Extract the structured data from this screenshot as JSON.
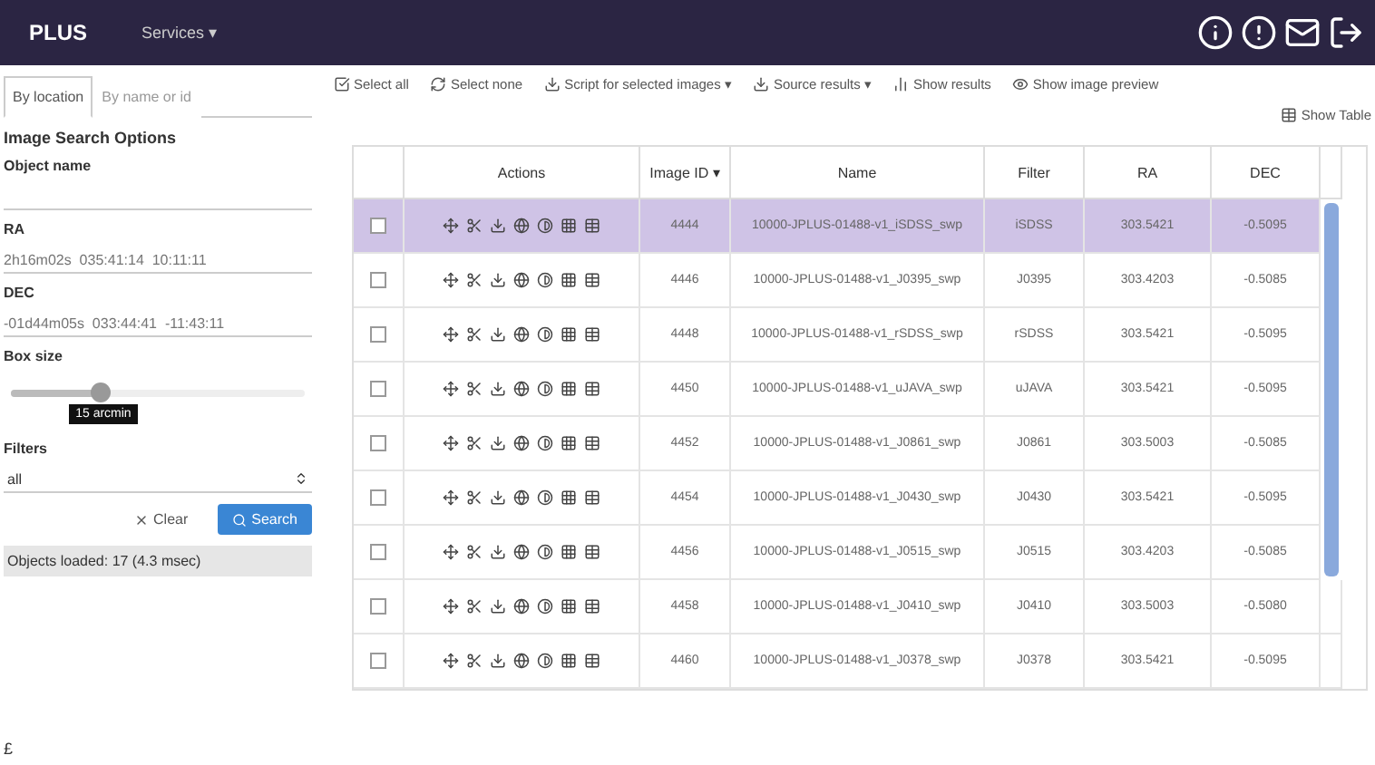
{
  "header": {
    "logo": "PLUS",
    "menu": "Services ▾"
  },
  "sidebar": {
    "tabs": [
      {
        "label": "By location",
        "selected": true
      },
      {
        "label": "By name or id",
        "selected": false
      }
    ],
    "title": "Image Search Options",
    "fields": [
      {
        "label": "Object name"
      },
      {
        "label": "RA",
        "placeholder": "2h16m02s  035:41:14  10:11:11"
      },
      {
        "label": "DEC",
        "placeholder": "-01d44m05s  033:44:41  -11:43:11"
      }
    ],
    "slider": {
      "label": "Box size",
      "level": 0.3,
      "tooltip": "15 arcmin"
    },
    "filters": {
      "label": "Filters",
      "value": "all"
    },
    "buttons": [
      {
        "label": "Clear",
        "kind": "plain"
      },
      {
        "label": "Search",
        "kind": "primary"
      }
    ],
    "status": "Objects loaded: 17 (4.3 msec)",
    "footer": "£"
  },
  "toolbar": [
    "Select all",
    "Select none",
    "Script for selected images ▾",
    "Source results ▾",
    "Show results",
    "Show image preview"
  ],
  "show_table": "Show Table",
  "table": {
    "columns": [
      "Actions",
      "Image ID ▾",
      "Name",
      "Filter",
      "RA",
      "DEC"
    ],
    "rows": [
      {
        "selected": true,
        "id": "4444",
        "name": "10000-JPLUS-01488-v1_iSDSS_swp",
        "filter": "iSDSS",
        "ra": "303.5421",
        "dec": "-0.5095"
      },
      {
        "selected": false,
        "id": "4446",
        "name": "10000-JPLUS-01488-v1_J0395_swp",
        "filter": "J0395",
        "ra": "303.4203",
        "dec": "-0.5085"
      },
      {
        "selected": false,
        "id": "4448",
        "name": "10000-JPLUS-01488-v1_rSDSS_swp",
        "filter": "rSDSS",
        "ra": "303.5421",
        "dec": "-0.5095"
      },
      {
        "selected": false,
        "id": "4450",
        "name": "10000-JPLUS-01488-v1_uJAVA_swp",
        "filter": "uJAVA",
        "ra": "303.5421",
        "dec": "-0.5095"
      },
      {
        "selected": false,
        "id": "4452",
        "name": "10000-JPLUS-01488-v1_J0861_swp",
        "filter": "J0861",
        "ra": "303.5003",
        "dec": "-0.5085"
      },
      {
        "selected": false,
        "id": "4454",
        "name": "10000-JPLUS-01488-v1_J0430_swp",
        "filter": "J0430",
        "ra": "303.5421",
        "dec": "-0.5095"
      },
      {
        "selected": false,
        "id": "4456",
        "name": "10000-JPLUS-01488-v1_J0515_swp",
        "filter": "J0515",
        "ra": "303.4203",
        "dec": "-0.5085"
      },
      {
        "selected": false,
        "id": "4458",
        "name": "10000-JPLUS-01488-v1_J0410_swp",
        "filter": "J0410",
        "ra": "303.5003",
        "dec": "-0.5080"
      },
      {
        "selected": false,
        "id": "4460",
        "name": "10000-JPLUS-01488-v1_J0378_swp",
        "filter": "J0378",
        "ra": "303.5421",
        "dec": "-0.5095"
      }
    ]
  }
}
